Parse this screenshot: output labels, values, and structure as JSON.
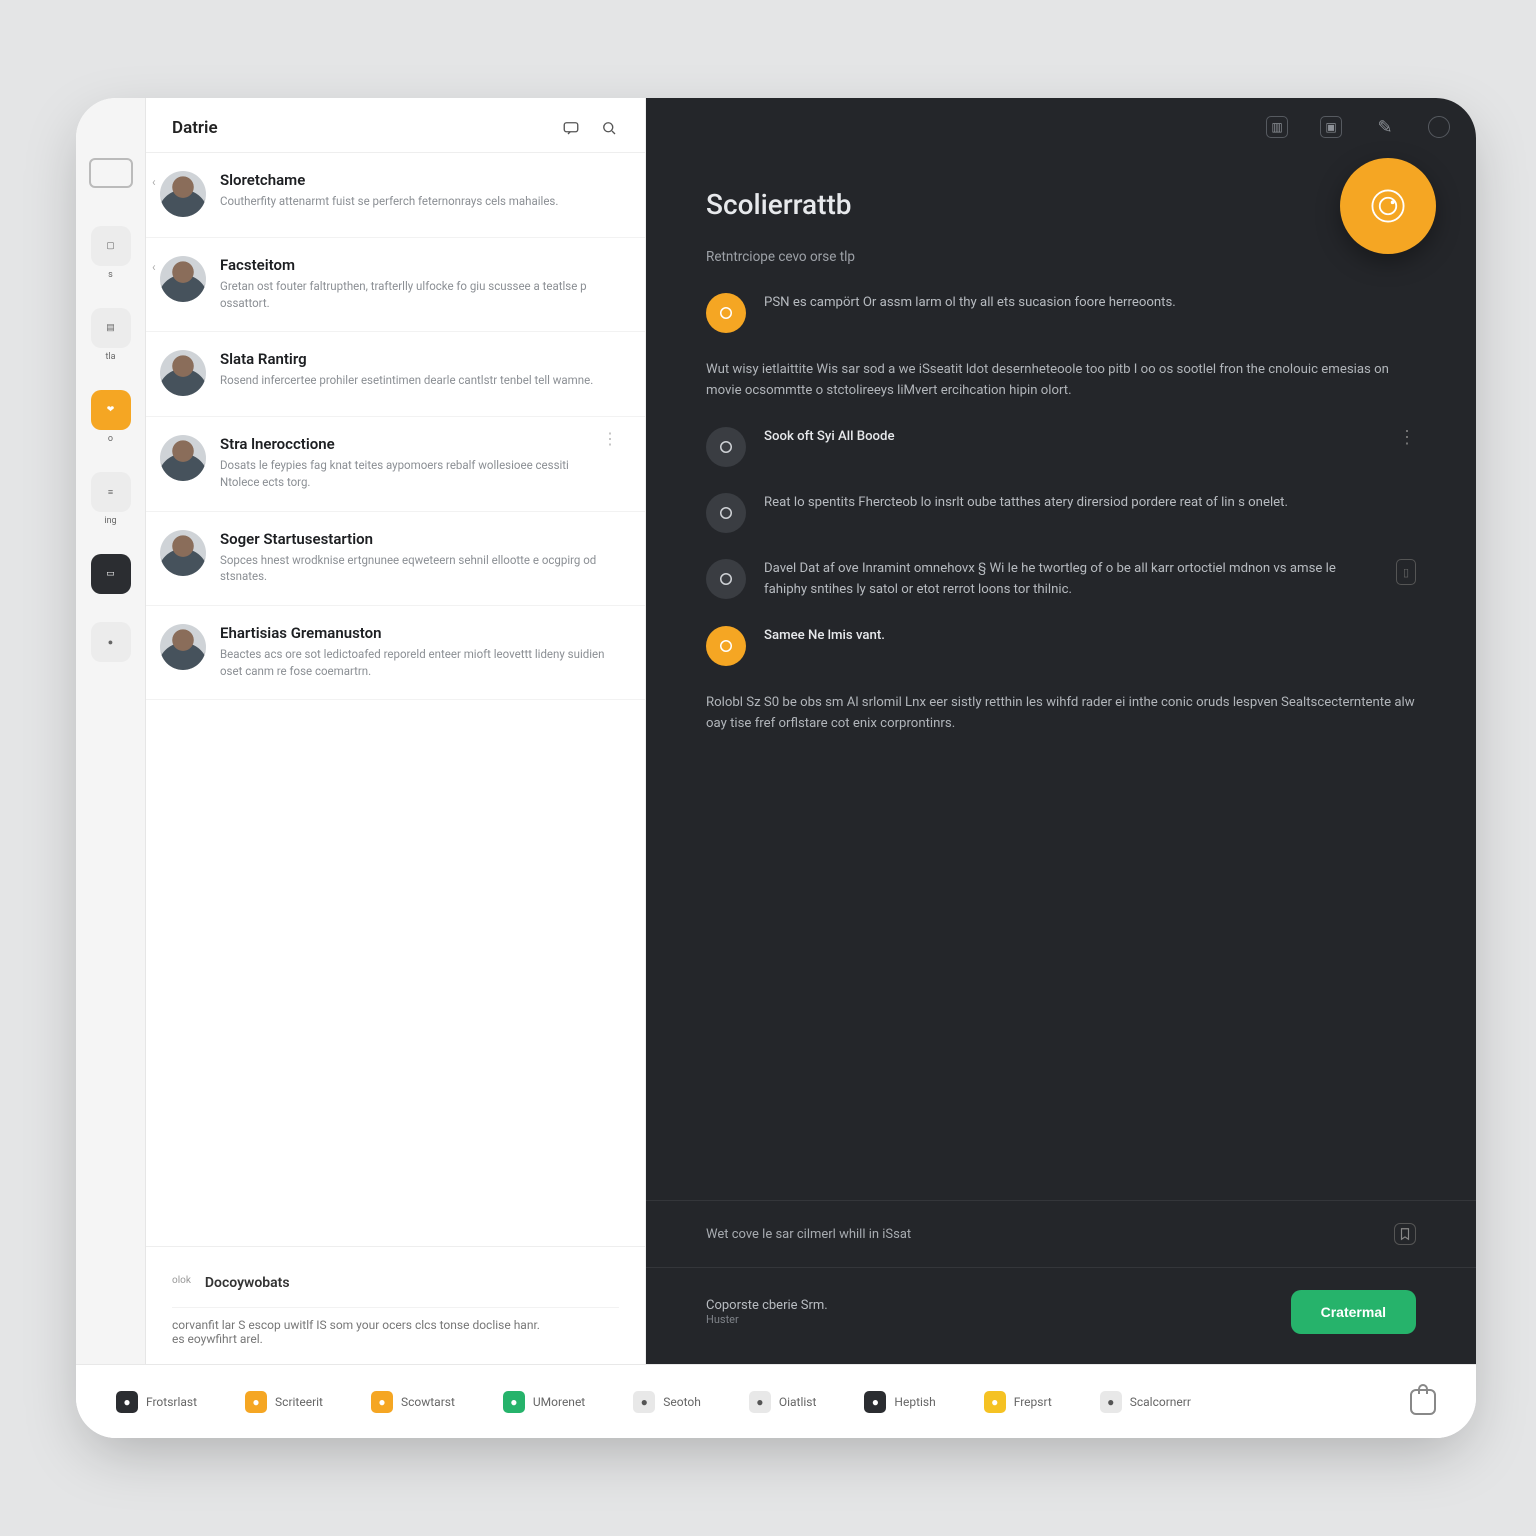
{
  "rail": {
    "items": [
      {
        "label": "s"
      },
      {
        "label": "tla"
      },
      {
        "label": "o"
      },
      {
        "label": "ing"
      },
      {
        "label": ""
      },
      {
        "label": ""
      }
    ]
  },
  "list": {
    "title": "Datrie",
    "people": [
      {
        "name": "Sloretchame",
        "blurb": "Coutherfity attenarmt fuist se perferch feternonrays cels mahailes."
      },
      {
        "name": "Facsteitom",
        "blurb": "Gretan ost fouter faltrupthen, trafterlly ulfocke fo giu scussee a teatlse p ossattort."
      },
      {
        "name": "Slata Rantirg",
        "blurb": "Rosend infercertee prohiler esetintimen dearle cantlstr tenbel tell wamne."
      },
      {
        "name": "Stra lnerocctione",
        "blurb": "Dosats le feypies fag knat teites aypomoers rebalf wollesioee cessiti Ntolece ects torg."
      },
      {
        "name": "Soger Startusestartion",
        "blurb": "Sopces hnest wrodknise ertgnunee eqweteern sehnil ellootte e ocgpirg od stsnates."
      },
      {
        "name": "Ehartisias Gremanuston",
        "blurb": "Beactes acs ore sot ledictoafed reporeld enteer mioft leovettt lideny suidien oset canm re fose coemartrn."
      }
    ],
    "footer": {
      "left_tag": "olok",
      "tag": "Docoywobats",
      "line1": "corvanfit lar S escop uwitlf IS som your ocers clcs tonse doclise hanr.",
      "line2": "es eoywfihrt arel."
    }
  },
  "content": {
    "title": "Scolierrattb",
    "subtitle": "Retntrciope cevo orse tlp",
    "items": [
      {
        "kind": "accent",
        "text": "PSN es campört Or assm larm ol thy all ets sucasion foore herreoonts."
      },
      {
        "kind": "para",
        "text": "Wut wisy ietlaittite Wis sar sod a we iSseatit ldot desernheteoole too pitb I oo os sootlel fron the cnolouic emesias on movie ocsommtte o stctolireeys liMvert ercihcation hipin olort."
      },
      {
        "kind": "plain",
        "label": "Sook oft Syi All Boode",
        "more": true
      },
      {
        "kind": "plain",
        "text": "Reat lo spentits Fhercteob lo insrlt oube tatthes atery dirersiod pordere reat of lin s onelet."
      },
      {
        "kind": "plain",
        "text": "Davel Dat af ove Inramint omnehovx § Wi le he twortleg of o be all karr ortoctiel mdnon vs amse le fahiphy sntihes ly satol or etot rerrot loons tor thilnic.",
        "side": true
      },
      {
        "kind": "accent",
        "label": "Samee Ne lmis vant."
      },
      {
        "kind": "para",
        "text": "Rolobl Sz S0 be obs sm Al srlomil Lnx eer sistly retthin les wihfd rader ei inthe conic oruds lespven Sealtscecterntente alw oay tise fref orflstare cot enix corprontinrs."
      }
    ],
    "footer1": "Wet cove le sar cilmerl whill in iSsat",
    "footer2_label": "Coporste cberie Srm.",
    "footer2_sub": "Huster",
    "cta": "Cratermal"
  },
  "nav": {
    "items": [
      {
        "label": "Frotsrlast",
        "style": "dark"
      },
      {
        "label": "Scriteerit",
        "style": "accent"
      },
      {
        "label": "Scowtarst",
        "style": "accent"
      },
      {
        "label": "UMorenet",
        "style": "green"
      },
      {
        "label": "Seotoh",
        "style": ""
      },
      {
        "label": "Oiatlist",
        "style": ""
      },
      {
        "label": "Heptish",
        "style": "dark"
      },
      {
        "label": "Frepsrt",
        "style": "yellow"
      },
      {
        "label": "Scalcornerr",
        "style": ""
      }
    ]
  }
}
